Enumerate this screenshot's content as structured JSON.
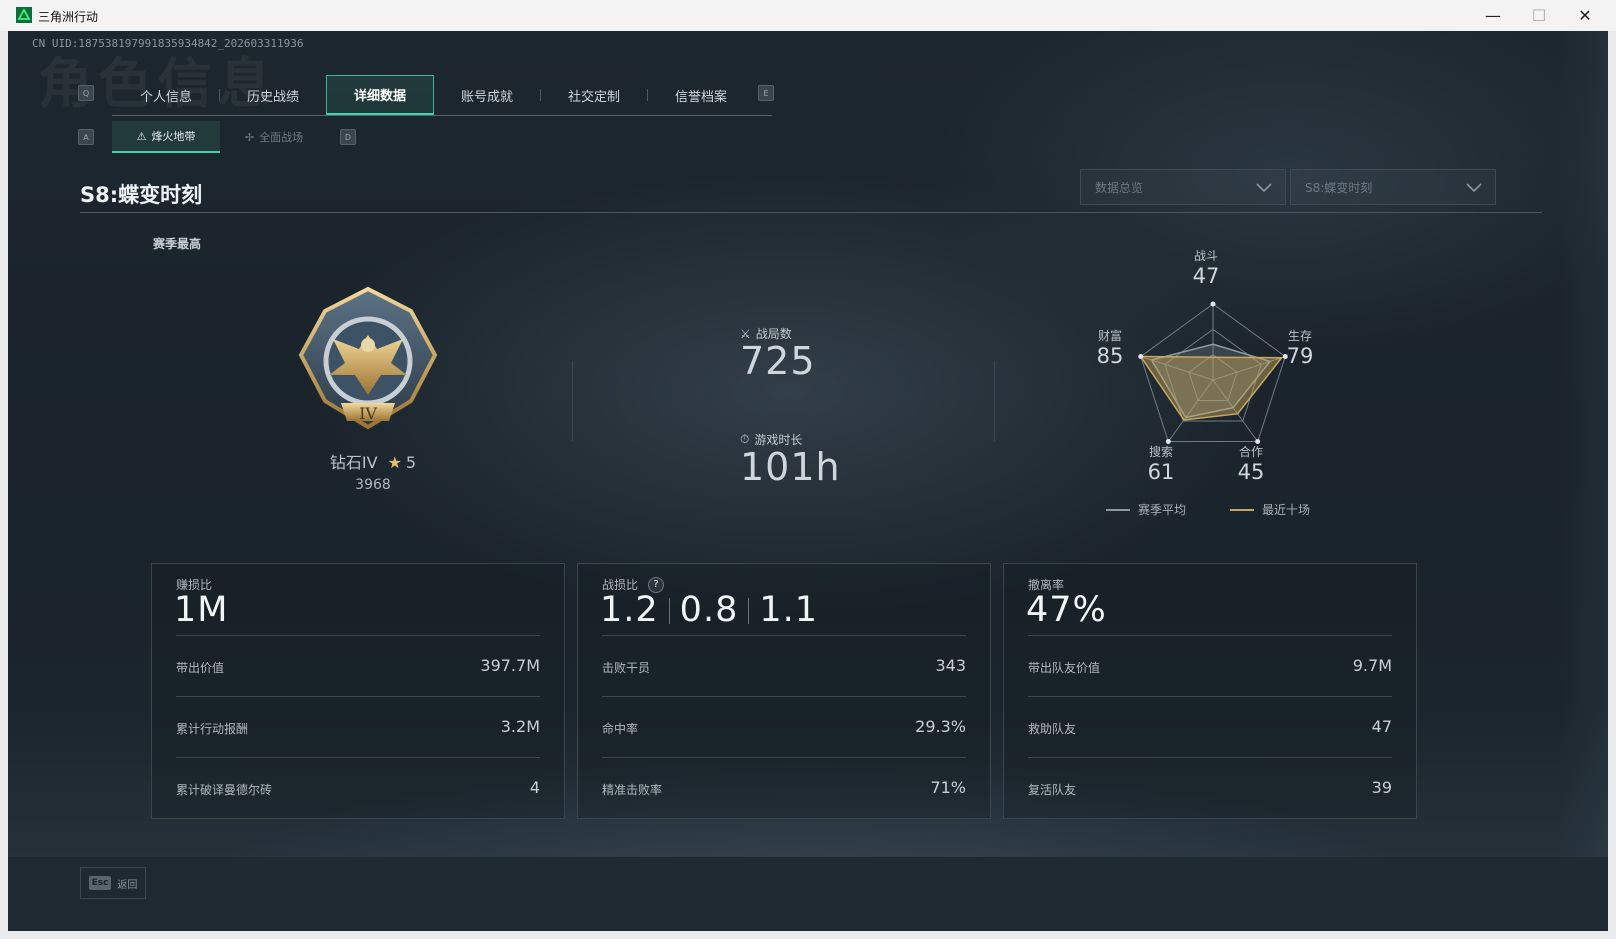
{
  "window": {
    "title": "三角洲行动",
    "minimize_glyph": "—",
    "maximize_glyph": "☐",
    "close_glyph": "✕"
  },
  "uid": "CN UID:18753819799183593484​2_202603311936",
  "watermark": "角色信息",
  "tabs": {
    "prev_key": "Q",
    "next_key": "E",
    "items": [
      {
        "label": "个人信息"
      },
      {
        "label": "历史战绩"
      },
      {
        "label": "详细数据",
        "active": true
      },
      {
        "label": "账号成就"
      },
      {
        "label": "社交定制"
      },
      {
        "label": "信誉档案"
      }
    ]
  },
  "subtabs": {
    "prev_key": "A",
    "next_key": "D",
    "items": [
      {
        "label": "烽火地带",
        "icon": "flame-zone-icon",
        "active": true
      },
      {
        "label": "全面战场",
        "icon": "battlefield-icon",
        "active": false
      }
    ]
  },
  "season": {
    "title": "S8:蝶变时刻",
    "best_label": "赛季最高",
    "rank_name": "钻石IV",
    "stars": "5",
    "score": "3968",
    "badge_numeral": "IV"
  },
  "filters": {
    "overview": "数据总览",
    "season": "S8:蝶变时刻"
  },
  "summary": {
    "matches_label": "战局数",
    "matches_value": "725",
    "playtime_label": "游戏时长",
    "playtime_value": "101h"
  },
  "radar": {
    "axes": [
      {
        "name": "战斗",
        "value": "47"
      },
      {
        "name": "生存",
        "value": "79"
      },
      {
        "name": "合作",
        "value": "45"
      },
      {
        "name": "搜索",
        "value": "61"
      },
      {
        "name": "财富",
        "value": "85"
      }
    ],
    "season_avg": [
      0.47,
      0.79,
      0.45,
      0.61,
      0.85
    ],
    "recent": [
      0.3,
      0.95,
      0.55,
      0.65,
      1.0
    ],
    "legend_avg": "赛季平均",
    "legend_recent": "最近十场",
    "color_avg": "#8e9aa3",
    "color_recent": "#c9a85a"
  },
  "cards": {
    "profit": {
      "label": "赚损比",
      "value": "1M",
      "rows": [
        {
          "label": "带出价值",
          "value": "397.7M"
        },
        {
          "label": "累计行动报酬",
          "value": "3.2M"
        },
        {
          "label": "累计破译曼德尔砖",
          "value": "4"
        }
      ]
    },
    "kd": {
      "label": "战损比",
      "help": "?",
      "values": [
        "1.2",
        "0.8",
        "1.1"
      ],
      "rows": [
        {
          "label": "击败干员",
          "value": "343"
        },
        {
          "label": "命中率",
          "value": "29.3%"
        },
        {
          "label": "精准击败率",
          "value": "71%"
        }
      ]
    },
    "extract": {
      "label": "撤离率",
      "value": "47%",
      "rows": [
        {
          "label": "带出队友价值",
          "value": "9.7M"
        },
        {
          "label": "救助队友",
          "value": "47"
        },
        {
          "label": "复活队友",
          "value": "39"
        }
      ]
    }
  },
  "footer": {
    "esc_key": "Esc",
    "back_label": "返回"
  },
  "colors": {
    "accent": "#3bd4a8",
    "gold": "#c9a85a"
  }
}
